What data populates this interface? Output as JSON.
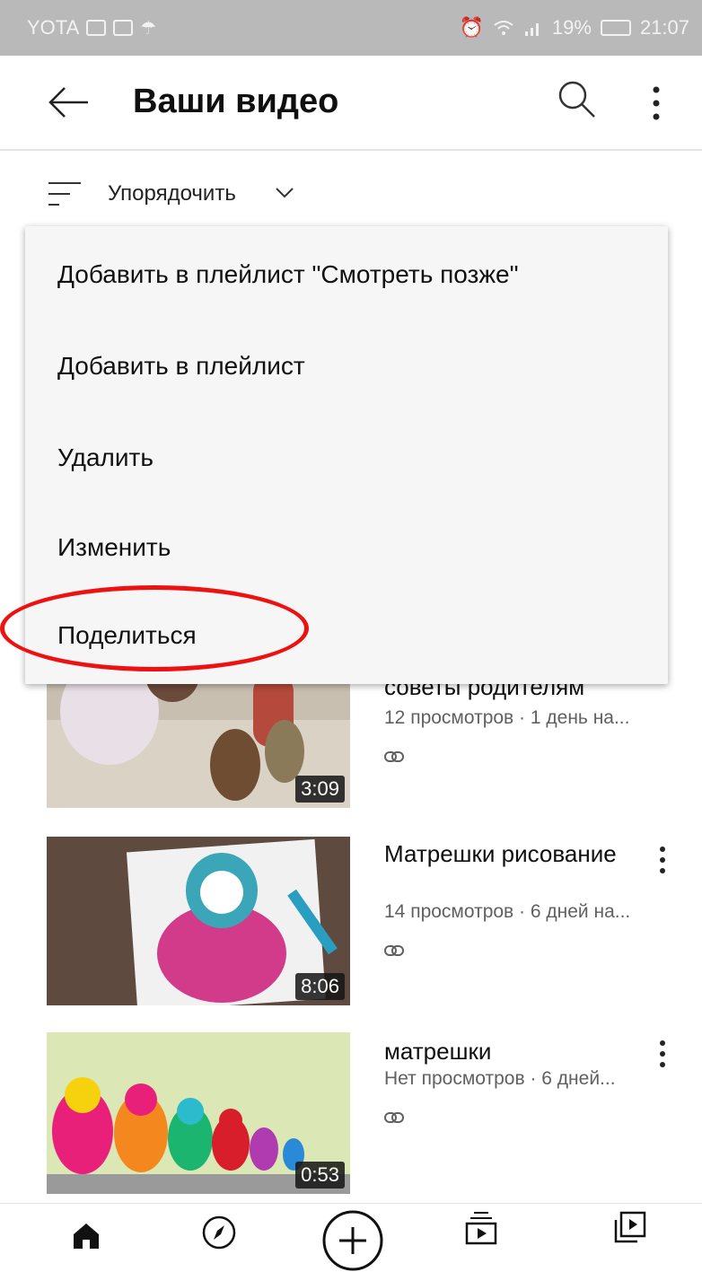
{
  "status_bar": {
    "carrier": "YOTA",
    "battery": "19%",
    "time": "21:07"
  },
  "app_bar": {
    "title": "Ваши видео",
    "icons": [
      "back-arrow-icon",
      "search-icon",
      "more-vert-icon"
    ]
  },
  "sort": {
    "label": "Упорядочить"
  },
  "context_menu": {
    "items": [
      "Добавить в плейлист \"Смотреть позже\"",
      "Добавить в плейлист",
      "Удалить",
      "Изменить",
      "Поделиться"
    ],
    "highlighted_item": "Поделиться",
    "highlight_color": "#ee1111"
  },
  "videos": [
    {
      "title": "советы родителям",
      "meta": "12 просмотров · 1 день на...",
      "duration": "3:09"
    },
    {
      "title": "Матрешки рисование",
      "meta": "14 просмотров · 6 дней на...",
      "duration": "8:06"
    },
    {
      "title": "матрешки",
      "meta": "Нет просмотров · 6 дней...",
      "duration": "0:53"
    }
  ],
  "bottom_nav": {
    "icons": [
      "home-icon",
      "explore-icon",
      "create-icon",
      "subscriptions-icon",
      "library-icon"
    ]
  }
}
